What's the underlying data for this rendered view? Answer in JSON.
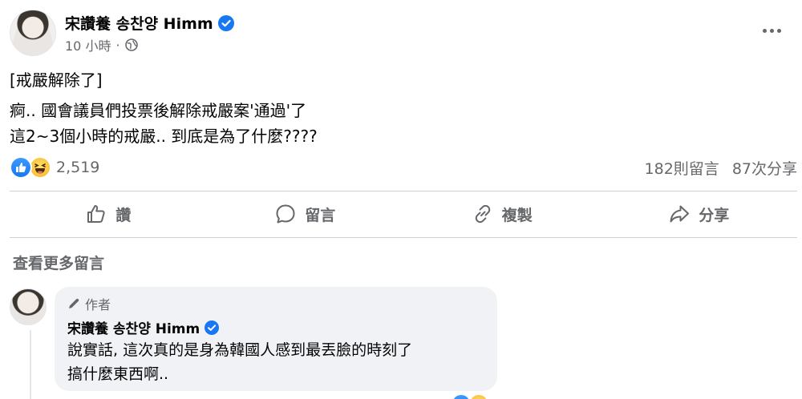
{
  "post": {
    "author": "宋讚養 송찬양 Himm",
    "time": "10 小時",
    "visibility_icon": "globe-icon",
    "lines": [
      "[戒嚴解除了]",
      "",
      "痾.. 國會議員們投票後解除戒嚴案'通過'了",
      "這2~3個小時的戒嚴.. 到底是為了什麼????"
    ]
  },
  "reactions": {
    "types": [
      "like-icon",
      "haha-icon"
    ],
    "count": "2,519",
    "comments": "182則留言",
    "shares": "87次分享"
  },
  "actions": {
    "like": "讚",
    "comment": "留言",
    "copy": "複製",
    "share": "分享"
  },
  "comments_section": {
    "view_more": "查看更多留言"
  },
  "comment": {
    "badge": "作者",
    "author": "宋讚養 송찬양 Himm",
    "line1": "說實話, 這次真的是身為韓國人感到最丟臉的時刻了",
    "line2": "搞什麼東西啊.."
  },
  "colors": {
    "accent": "#1877f2",
    "secondary_text": "#65676b",
    "bubble": "#f0f2f5"
  }
}
